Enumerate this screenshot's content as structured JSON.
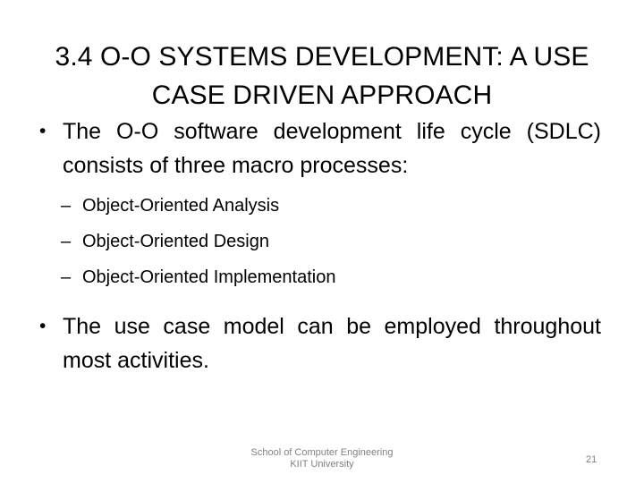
{
  "slide": {
    "background_color": "#ffffff",
    "text_color": "#000000",
    "footer_color": "#808080",
    "title": "3.4  O-O  SYSTEMS DEVELOPMENT: A USE CASE DRIVEN APPROACH",
    "bullets": [
      {
        "marker": "•",
        "text": "The O-O software development life cycle (SDLC) consists of three macro processes:",
        "sub_bullets": [
          {
            "marker": "–",
            "text": "Object-Oriented Analysis"
          },
          {
            "marker": "–",
            "text": "Object-Oriented Design"
          },
          {
            "marker": "–",
            "text": "Object-Oriented Implementation"
          }
        ]
      },
      {
        "marker": "•",
        "text": "The use case model can be employed throughout most activities.",
        "sub_bullets": []
      }
    ],
    "footer": {
      "line1": "School of Computer Engineering",
      "line2": "KIIT University"
    },
    "page_number": "21"
  }
}
